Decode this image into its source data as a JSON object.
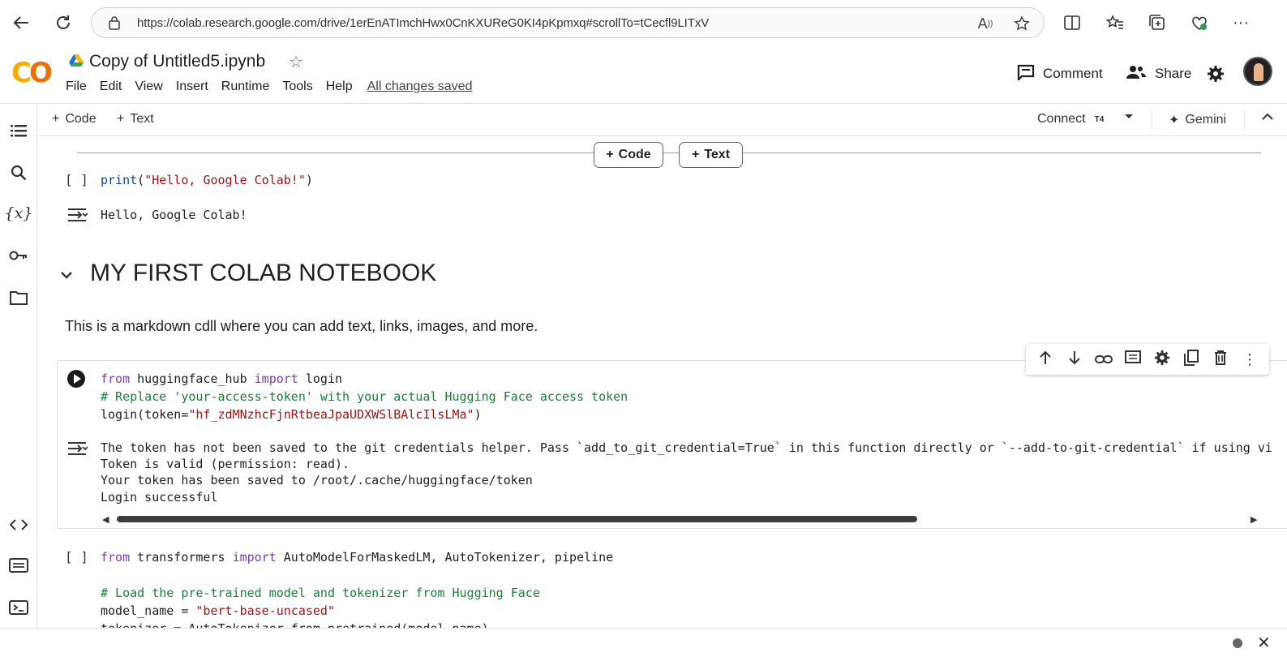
{
  "browser": {
    "url": "https://colab.research.google.com/drive/1erEnATImchHwx0CnKXUReG0KI4pKpmxq#scrollTo=tCecfl9LITxV",
    "icons": [
      "back-icon",
      "refresh-icon",
      "lock-icon",
      "read-aloud-icon",
      "favorite-star-icon",
      "split-screen-icon",
      "favorites-icon",
      "collections-icon",
      "performance-icon",
      "more-icon"
    ]
  },
  "header": {
    "logo": "CO",
    "title": "Copy of Untitled5.ipynb",
    "menu": [
      "File",
      "Edit",
      "View",
      "Insert",
      "Runtime",
      "Tools",
      "Help"
    ],
    "save_status": "All changes saved",
    "comment_label": "Comment",
    "share_label": "Share"
  },
  "toolbar": {
    "add_code": "Code",
    "add_text": "Text",
    "connect_label": "Connect",
    "runtime_badge": "T4",
    "gemini_label": "Gemini"
  },
  "insert_buttons": {
    "code": "Code",
    "text": "Text"
  },
  "cells": {
    "cell1": {
      "bracket": "[ ]",
      "code_fn": "print",
      "code_open": "(",
      "code_str": "\"Hello, Google Colab!\"",
      "code_close": ")",
      "output": "Hello, Google Colab!"
    },
    "section": {
      "heading": "MY FIRST COLAB NOTEBOOK",
      "markdown": "This is a markdown cdll where you can add text, links, images, and more."
    },
    "cell2": {
      "line1_kw1": "from",
      "line1_mod": " huggingface_hub ",
      "line1_kw2": "import",
      "line1_name": " login",
      "line2_comment": "# Replace 'your-access-token' with your actual Hugging Face access token",
      "line3_pre": "login(token=",
      "line3_str": "\"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\"",
      "line3_post": ")",
      "output": [
        "The token has not been saved to the git credentials helper. Pass `add_to_git_credential=True` in this function directly or `--add-to-git-credential` if using vi",
        "Token is valid (permission: read).",
        "Your token has been saved to /root/.cache/huggingface/token",
        "Login successful"
      ]
    },
    "cell3": {
      "bracket": "[ ]",
      "line1_kw1": "from",
      "line1_mod": " transformers ",
      "line1_kw2": "import",
      "line1_rest": " AutoModelForMaskedLM, AutoTokenizer, pipeline",
      "line2_comment": "# Load the pre-trained model and tokenizer from Hugging Face",
      "line3_pre": "model_name = ",
      "line3_str": "\"bert-base-uncased\"",
      "line4_partial": "tokenizer = AutoTokenizer.from_pretrained(model_name)"
    }
  },
  "colors": {
    "keyword": "#7b3fa4",
    "string": "#a31515",
    "comment": "#188038",
    "logo_yellow": "#f9ab00",
    "logo_orange": "#e8710a"
  }
}
